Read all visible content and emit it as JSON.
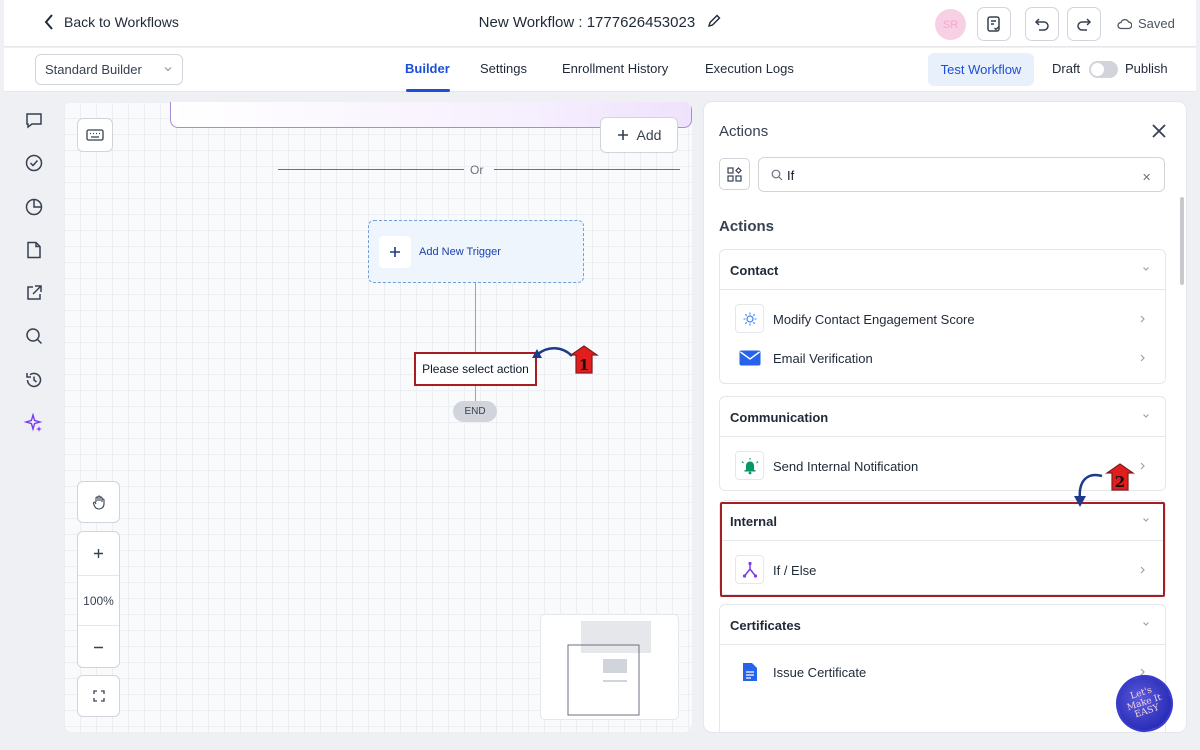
{
  "header": {
    "back_label": "Back to Workflows",
    "workflow_title": "New Workflow : 1777626453023",
    "avatar_initials": "SR",
    "saved_label": "Saved"
  },
  "subheader": {
    "builder_mode": "Standard Builder",
    "tabs": [
      "Builder",
      "Settings",
      "Enrollment History",
      "Execution Logs"
    ],
    "active_tab": "Builder",
    "test_workflow_label": "Test Workflow",
    "draft_label": "Draft",
    "publish_label": "Publish",
    "publish_on": false
  },
  "canvas": {
    "add_label": "Add",
    "or_label": "Or",
    "add_trigger_label": "Add New Trigger",
    "select_action_label": "Please select action",
    "end_label": "END",
    "zoom_level": "100%"
  },
  "panel": {
    "title": "Actions",
    "search_value": "If",
    "section_heading": "Actions",
    "categories": [
      {
        "name": "Contact",
        "items": [
          {
            "label": "Modify Contact Engagement Score",
            "icon": "engagement-score-icon"
          },
          {
            "label": "Email Verification",
            "icon": "envelope-icon"
          }
        ]
      },
      {
        "name": "Communication",
        "items": [
          {
            "label": "Send Internal Notification",
            "icon": "bell-icon"
          }
        ]
      },
      {
        "name": "Internal",
        "items": [
          {
            "label": "If / Else",
            "icon": "branch-icon"
          }
        ]
      },
      {
        "name": "Certificates",
        "items": [
          {
            "label": "Issue Certificate",
            "icon": "document-icon"
          }
        ]
      }
    ]
  },
  "annotations": {
    "step1": "1",
    "step2": "2",
    "watermark": "Let's Make It EASY"
  },
  "colors": {
    "accent": "#1d4ed8",
    "highlight": "#a61e22",
    "trigger_border": "#a78bd4"
  }
}
